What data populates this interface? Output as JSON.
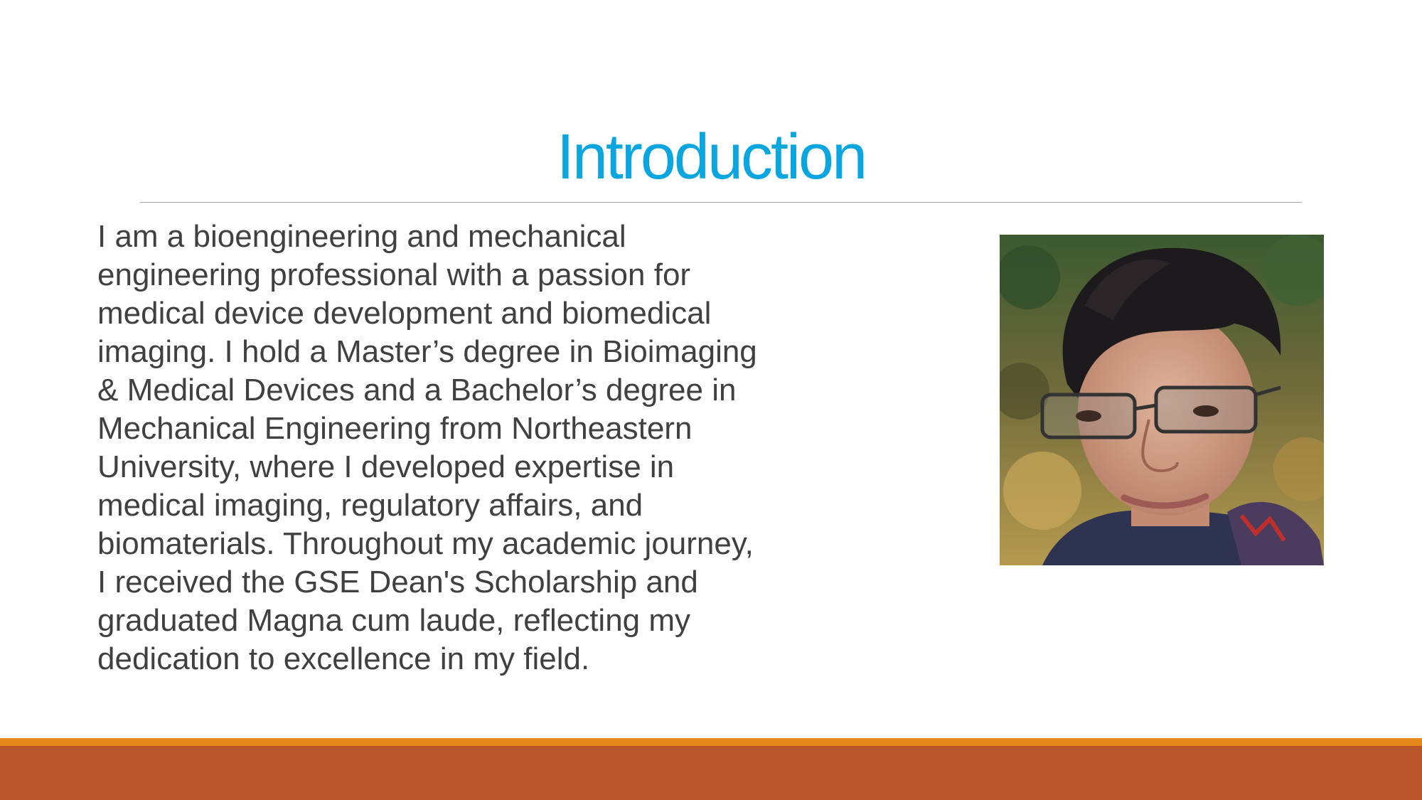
{
  "slide": {
    "title": "Introduction",
    "body": "I am a bioengineering and mechanical\nengineering professional with a passion for\nmedical device development and biomedical\nimaging. I hold a Master’s degree in Bioimaging\n& Medical Devices and a Bachelor’s degree in\nMechanical Engineering from Northeastern\nUniversity, where I developed expertise in\nmedical imaging, regulatory affairs, and\nbiomaterials. Throughout my academic journey,\nI received the GSE Dean's Scholarship and\ngraduated Magna cum laude, reflecting my\ndedication to excellence in my field.",
    "photo_icon": "portrait-photo"
  },
  "colors": {
    "title": "#0ba6df",
    "body_text": "#404040",
    "divider": "#a6a6a6",
    "accent_band": "#e5861a",
    "bottom_band": "#b8562b"
  }
}
